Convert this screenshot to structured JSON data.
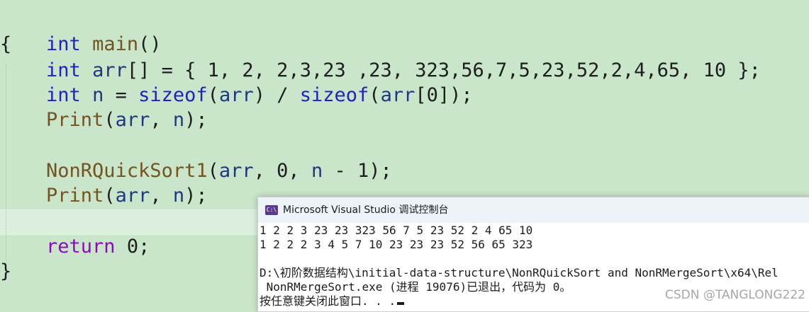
{
  "code": {
    "l1": {
      "kw": "int",
      "fn": "main",
      "rest": "()"
    },
    "l2": "{",
    "l3": {
      "kw": "int",
      "var": "arr",
      "rest": "[] = { 1, 2, 2,3,23 ,23, 323,56,7,5,23,52,2,4,65, 10 };"
    },
    "l4": {
      "kw": "int",
      "var": "n",
      "eq": " = ",
      "sizeof1": "sizeof",
      "p1": "(",
      "arr1": "arr",
      "p2": ") / ",
      "sizeof2": "sizeof",
      "p3": "(",
      "arr2": "arr",
      "p4": "[0]);"
    },
    "l5": {
      "fn": "Print",
      "p1": "(",
      "a": "arr",
      "c": ", ",
      "b": "n",
      "p2": ");"
    },
    "l6": {
      "fn": "NonRQuickSort1",
      "p1": "(",
      "a": "arr",
      "c": ", 0, ",
      "b": "n",
      "p2": " - 1);"
    },
    "l7": {
      "fn": "Print",
      "p1": "(",
      "a": "arr",
      "c": ", ",
      "b": "n",
      "p2": ");"
    },
    "l8": {
      "kw": "return",
      "rest": " 0;"
    },
    "l9": "}"
  },
  "console": {
    "icon_text": "C:\\",
    "title": "Microsoft Visual Studio 调试控制台",
    "lines": [
      "1 2 2 3 23 23 323 56 7 5 23 52 2 4 65 10",
      "1 2 2 2 3 4 5 7 10 23 23 23 52 56 65 323",
      "",
      "D:\\初阶数据结构\\initial-data-structure\\NonRQuickSort and NonRMergeSort\\x64\\Rel",
      " NonRMergeSort.exe (进程 19076)已退出，代码为 0。",
      "按任意键关闭此窗口. . ."
    ],
    "watermark": "CSDN @TANGLONG222"
  },
  "colors": {
    "editor_bg": "#c9e6cb",
    "keyword": "#1f21c2",
    "return_keyword": "#8f08c4",
    "function": "#74531f",
    "variable": "#1f377f"
  }
}
